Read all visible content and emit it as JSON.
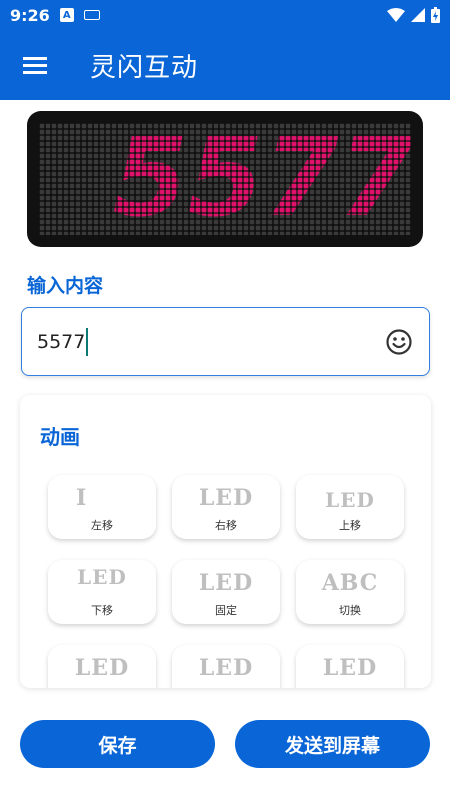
{
  "status_bar": {
    "time": "9:26",
    "left_icons": [
      "translate-app-icon",
      "keyboard-icon"
    ],
    "right_icons": [
      "wifi-icon",
      "cellular-signal-icon",
      "battery-charging-icon"
    ]
  },
  "app_bar": {
    "menu_icon": "menu-icon",
    "title": "灵闪互动"
  },
  "led_preview": {
    "text": "5577",
    "text_color": "#e0106b",
    "background_color": "#111111",
    "pixel_off_color": "#3a3a3a"
  },
  "input": {
    "label": "输入内容",
    "value": "5577",
    "emoji_icon": "emoji-smile-icon"
  },
  "animation": {
    "title": "动画",
    "items": [
      {
        "preview": "I",
        "label": "左移"
      },
      {
        "preview": "LED",
        "label": "右移"
      },
      {
        "preview": "LED",
        "label": "上移"
      },
      {
        "preview": "LED",
        "label": "下移"
      },
      {
        "preview": "LED",
        "label": "固定"
      },
      {
        "preview": "ABC",
        "label": "切换"
      },
      {
        "preview": "LED",
        "label": ""
      },
      {
        "preview": "LED",
        "label": ""
      },
      {
        "preview": "LED",
        "label": ""
      }
    ]
  },
  "buttons": {
    "save": "保存",
    "send": "发送到屏幕"
  },
  "colors": {
    "primary": "#0a66d6",
    "led_text": "#e0106b"
  }
}
